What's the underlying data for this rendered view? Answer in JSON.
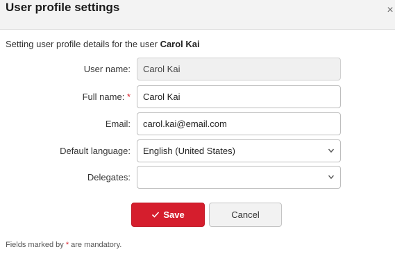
{
  "dialog": {
    "title": "User profile settings",
    "close_glyph": "×",
    "intro_prefix": "Setting user profile details for the user ",
    "intro_user": "Carol Kai"
  },
  "form": {
    "username": {
      "label": "User name:",
      "value": "Carol Kai"
    },
    "fullname": {
      "label": "Full name:",
      "required_mark": "*",
      "value": "Carol Kai"
    },
    "email": {
      "label": "Email:",
      "value": "carol.kai@email.com"
    },
    "language": {
      "label": "Default language:",
      "value": "English (United States)"
    },
    "delegates": {
      "label": "Delegates:",
      "value": ""
    }
  },
  "buttons": {
    "save_label": "Save",
    "cancel_label": "Cancel"
  },
  "footer": {
    "prefix": "Fields marked by ",
    "mark": "*",
    "suffix": " are mandatory."
  },
  "colors": {
    "accent": "#d51e2d",
    "required": "#d9232e"
  },
  "icons": {
    "close": "close-icon",
    "save": "checkmark-icon",
    "dropdown": "chevron-down-icon"
  }
}
